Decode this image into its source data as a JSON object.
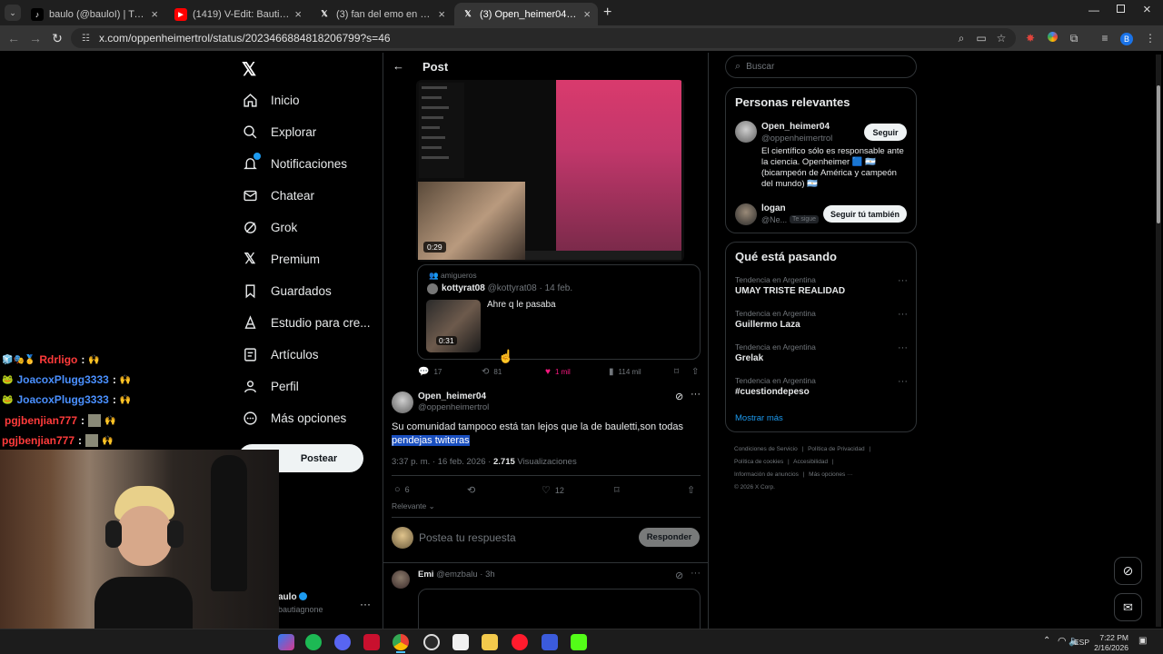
{
  "tabs": [
    {
      "title": "baulo (@bauloI) | TikTok",
      "icon": "tiktok-icon"
    },
    {
      "title": "(1419) V-Edit: Bauti Agnone - Y",
      "icon": "youtube-icon"
    },
    {
      "title": "(3) fan del emo en X: \"@elbaja",
      "icon": "x-logo-icon"
    },
    {
      "title": "(3) Open_heimer04 en X: \"@Ne",
      "icon": "x-logo-icon"
    }
  ],
  "address": {
    "url": "x.com/oppenheimertrol/status/2023466884818206799?s=46"
  },
  "nav": {
    "items": [
      {
        "label": "Inicio",
        "icon": "home-icon"
      },
      {
        "label": "Explorar",
        "icon": "search-icon"
      },
      {
        "label": "Notificaciones",
        "icon": "bell-icon"
      },
      {
        "label": "Chatear",
        "icon": "mail-icon"
      },
      {
        "label": "Grok",
        "icon": "grok-icon"
      },
      {
        "label": "Premium",
        "icon": "x-logo-icon"
      },
      {
        "label": "Guardados",
        "icon": "bookmark-icon"
      },
      {
        "label": "Estudio para cre...",
        "icon": "creator-studio-icon"
      },
      {
        "label": "Artículos",
        "icon": "articles-icon"
      },
      {
        "label": "Perfil",
        "icon": "person-icon"
      },
      {
        "label": "Más opciones",
        "icon": "more-icon"
      }
    ],
    "post_button": "Postear",
    "account_name": "aulo",
    "account_handle": "bautiagnone"
  },
  "header": {
    "title": "Post"
  },
  "quoted": {
    "video1_duration": "0:29",
    "community": "amigueros",
    "author_name": "kottyrat08",
    "author_handle": "@kottyrat08",
    "date": "14 feb.",
    "text": "Ahre q le pasaba",
    "video2_duration": "0:31",
    "actions": {
      "replies": "17",
      "reposts": "81",
      "likes": "1 mil",
      "views": "114 mil"
    }
  },
  "post": {
    "author_name": "Open_heimer04",
    "author_handle": "@oppenheimertrol",
    "text_plain": "Su comunidad tampoco está tan lejos que la de bauletti,son todas",
    "text_highlight": "pendejas twiteras",
    "time": "3:37 p. m.",
    "date": "16 feb. 2026",
    "views_count": "2.715",
    "views_label": "Visualizaciones",
    "replies": "6",
    "likes": "12",
    "sort": "Relevante",
    "reply_placeholder": "Postea tu respuesta",
    "reply_button": "Responder"
  },
  "next_reply": {
    "author_name": "Emi",
    "author_handle": "@emzbalu",
    "time": "3h"
  },
  "search": {
    "placeholder": "Buscar"
  },
  "relevant": {
    "title": "Personas relevantes",
    "person1": {
      "name": "Open_heimer04",
      "handle": "@oppenheimertrol",
      "bio": "El científico sólo es responsable ante la ciencia. Openheimer 🟦 🇦🇷 (bicampeón de América y campeón del mundo) 🇦🇷",
      "button": "Seguir"
    },
    "person2": {
      "name": "logan",
      "handle": "@Ne...",
      "badge": "Te sigue",
      "button": "Seguir tú también"
    }
  },
  "trends": {
    "title": "Qué está pasando",
    "items": [
      {
        "category": "Tendencia en Argentina",
        "name": "UMAY TRISTE REALIDAD"
      },
      {
        "category": "Tendencia en Argentina",
        "name": "Guillermo Laza"
      },
      {
        "category": "Tendencia en Argentina",
        "name": "Grelak"
      },
      {
        "category": "Tendencia en Argentina",
        "name": "#cuestiondepeso"
      }
    ],
    "more": "Mostrar más"
  },
  "footer": {
    "links": [
      "Condiciones de Servicio",
      "Política de Privacidad",
      "Política de cookies",
      "Accesibilidad",
      "Información de anuncios",
      "Más opciones ···"
    ],
    "copyright": "© 2026 X Corp."
  },
  "chat": [
    {
      "user": "Rdrligo",
      "color": "#ff3b3b"
    },
    {
      "user": "JoacoxPlugg3333",
      "color": "#4a90ff"
    },
    {
      "user": "JoacoxPlugg3333",
      "color": "#4a90ff"
    },
    {
      "user": "pgjbenjian777",
      "color": "#ff3b3b"
    },
    {
      "user": "pgjbenjian777",
      "color": "#ff3b3b"
    }
  ],
  "taskbar": {
    "lang": "ESP",
    "time": "7:22 PM",
    "date": "2/16/2026"
  },
  "colors": {
    "bg": "#000000",
    "border": "#2f3336",
    "link": "#1d9bf0",
    "like": "#f91880",
    "highlight": "#1a4fbf"
  }
}
